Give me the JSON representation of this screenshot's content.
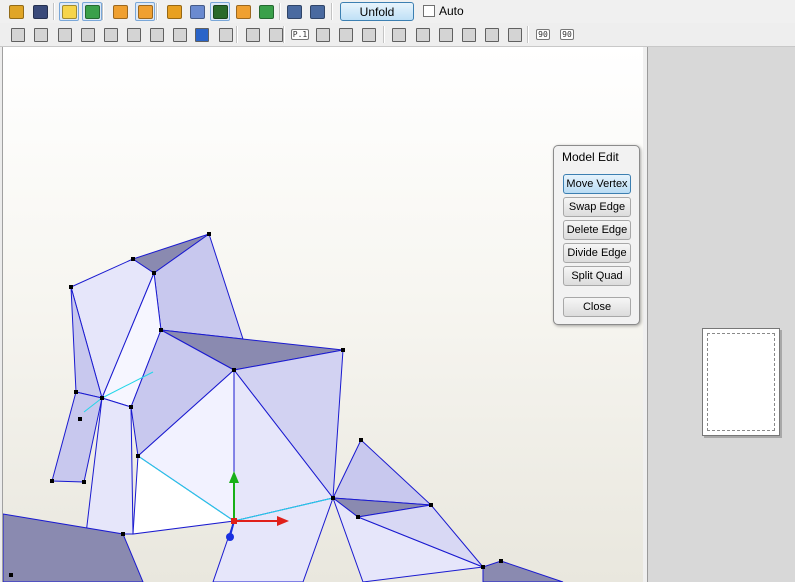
{
  "toolbar1": {
    "buttons": [
      {
        "name": "open-file-icon",
        "color": "#e0a526"
      },
      {
        "name": "save-icon",
        "color": "#3a4a7a"
      },
      {
        "name": "lightbulb-icon",
        "color": "#f6d44a",
        "active": true
      },
      {
        "name": "color-cube-icon",
        "color": "#3aa04a",
        "active": true
      },
      {
        "name": "box-3d-icon",
        "color": "#f0a030"
      },
      {
        "name": "box-3d-alt-icon",
        "color": "#f0a030",
        "active": true
      },
      {
        "name": "pencil-icon",
        "color": "#e8a020"
      },
      {
        "name": "cylinder-icon",
        "color": "#6a8ad0"
      },
      {
        "name": "anchor-icon",
        "color": "#2a6a2a",
        "active": true
      },
      {
        "name": "bar-chart-icon",
        "color": "#f0a030"
      },
      {
        "name": "green-box-icon",
        "color": "#3aa04a"
      },
      {
        "name": "single-page-icon",
        "color": "#4a6aa0"
      },
      {
        "name": "page-outline-icon",
        "color": "#4a6aa0"
      }
    ],
    "unfold_label": "Unfold",
    "auto_label": "Auto",
    "auto_checked": false
  },
  "toolbar2": {
    "buttons": [
      {
        "name": "select-icon"
      },
      {
        "name": "lasso-icon"
      },
      {
        "name": "ruler-icon"
      },
      {
        "name": "layers-icon"
      },
      {
        "name": "pieces-icon"
      },
      {
        "name": "columns-icon"
      },
      {
        "name": "image-icon"
      },
      {
        "name": "paint-icon"
      },
      {
        "name": "redo-icon",
        "color": "#2a64c8"
      },
      {
        "name": "undo-icon"
      },
      {
        "name": "crop-icon"
      },
      {
        "name": "fit-icon"
      },
      {
        "name": "page-number-icon",
        "text": "P.1"
      },
      {
        "name": "grid-icon"
      },
      {
        "name": "frame-icon"
      },
      {
        "name": "print-icon"
      },
      {
        "name": "align-left-icon"
      },
      {
        "name": "align-center-icon"
      },
      {
        "name": "align-right-icon"
      },
      {
        "name": "align-middle-icon"
      },
      {
        "name": "distribute-icon"
      },
      {
        "name": "align-bottom-icon"
      },
      {
        "name": "rotate-ccw-90-icon",
        "text": "90"
      },
      {
        "name": "rotate-cw-90-icon",
        "text": "90"
      }
    ]
  },
  "model_edit": {
    "title": "Model Edit",
    "buttons": [
      {
        "label": "Move Vertex",
        "active": true
      },
      {
        "label": "Swap Edge",
        "active": false
      },
      {
        "label": "Delete Edge",
        "active": false
      },
      {
        "label": "Divide Edge",
        "active": false
      },
      {
        "label": "Split Quad",
        "active": false
      }
    ],
    "close_label": "Close"
  },
  "colors": {
    "edge": "#1a1ad0",
    "selected_edge": "#22d6e8",
    "face_light": "#e6e6fa",
    "face_mid": "#c8c8ee",
    "face_dark": "#8a8ab0",
    "axis_x": "#e0201a",
    "axis_y": "#18b018",
    "axis_z": "#1a30e0"
  }
}
